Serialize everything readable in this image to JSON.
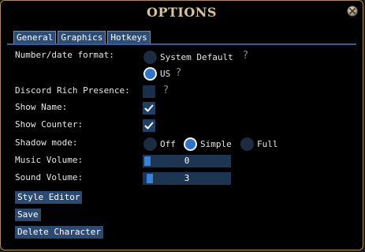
{
  "window": {
    "title": "OPTIONS",
    "close_icon": "close-icon"
  },
  "tabs": [
    {
      "label": "General",
      "active": true
    },
    {
      "label": "Graphics",
      "active": false
    },
    {
      "label": "Hotkeys",
      "active": false
    }
  ],
  "general": {
    "number_format": {
      "label": "Number/date format:",
      "options": [
        {
          "label": "System Default",
          "checked": false
        },
        {
          "label": "US",
          "checked": true
        }
      ]
    },
    "discord": {
      "label": "Discord Rich Presence:",
      "checked": false
    },
    "show_name": {
      "label": "Show Name:",
      "checked": true
    },
    "show_counter": {
      "label": "Show Counter:",
      "checked": true
    },
    "shadow_mode": {
      "label": "Shadow mode:",
      "options": [
        {
          "label": "Off",
          "checked": false
        },
        {
          "label": "Simple",
          "checked": true
        },
        {
          "label": "Full",
          "checked": false
        }
      ]
    },
    "music_volume": {
      "label": "Music Volume:",
      "value": "0",
      "fraction": 0.0
    },
    "sound_volume": {
      "label": "Sound Volume:",
      "value": "3",
      "fraction": 0.03
    }
  },
  "help_glyph": "?",
  "buttons": {
    "style_editor": "Style Editor",
    "save": "Save",
    "delete_character": "Delete Character"
  },
  "colors": {
    "accent": "#2f73c9",
    "title": "#d9c594",
    "tab_bg": "#2d4d76",
    "border": "#b08b45"
  }
}
